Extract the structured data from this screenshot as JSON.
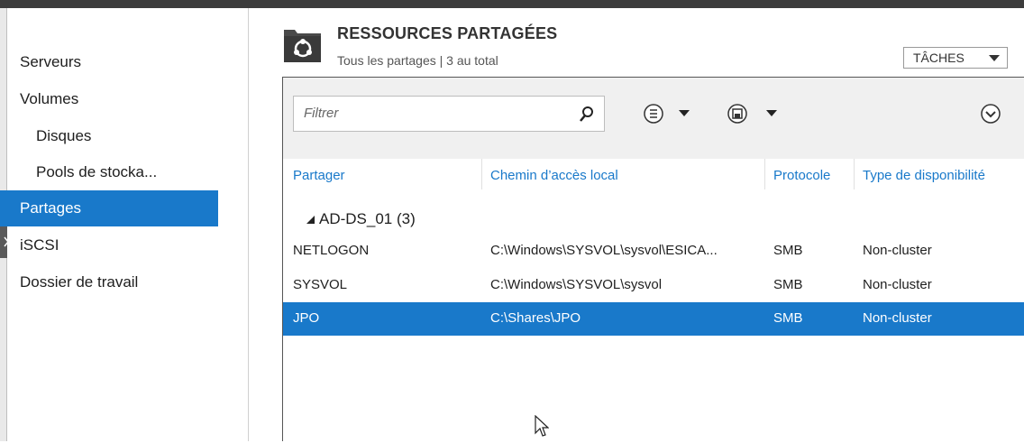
{
  "sidebar": {
    "items": [
      {
        "label": "Serveurs"
      },
      {
        "label": "Volumes"
      },
      {
        "label": "Disques"
      },
      {
        "label": "Pools de stocka..."
      },
      {
        "label": "Partages"
      },
      {
        "label": "iSCSI"
      },
      {
        "label": "Dossier de travail"
      }
    ],
    "selected": "Partages"
  },
  "header": {
    "title": "RESSOURCES PARTAGÉES",
    "subtitle": "Tous les partages | 3 au total",
    "icon": "shared-folder-icon",
    "tasks_label": "TÂCHES"
  },
  "toolbar": {
    "filter_placeholder": "Filtrer",
    "buttons": [
      "list-view-icon",
      "save-query-icon",
      "expand-icon"
    ]
  },
  "table": {
    "columns": [
      "Partager",
      "Chemin d’accès local",
      "Protocole",
      "Type de disponibilité"
    ],
    "group": {
      "label": "AD-DS_01 (3)"
    },
    "rows": [
      {
        "share": "NETLOGON",
        "path": "C:\\Windows\\SYSVOL\\sysvol\\ESICA...",
        "protocol": "SMB",
        "availability": "Non-cluster"
      },
      {
        "share": "SYSVOL",
        "path": "C:\\Windows\\SYSVOL\\sysvol",
        "protocol": "SMB",
        "availability": "Non-cluster"
      },
      {
        "share": "JPO",
        "path": "C:\\Shares\\JPO",
        "protocol": "SMB",
        "availability": "Non-cluster"
      }
    ],
    "selected_row": "JPO"
  },
  "colors": {
    "accent": "#1979ca",
    "topbar": "#3c3c3c"
  }
}
